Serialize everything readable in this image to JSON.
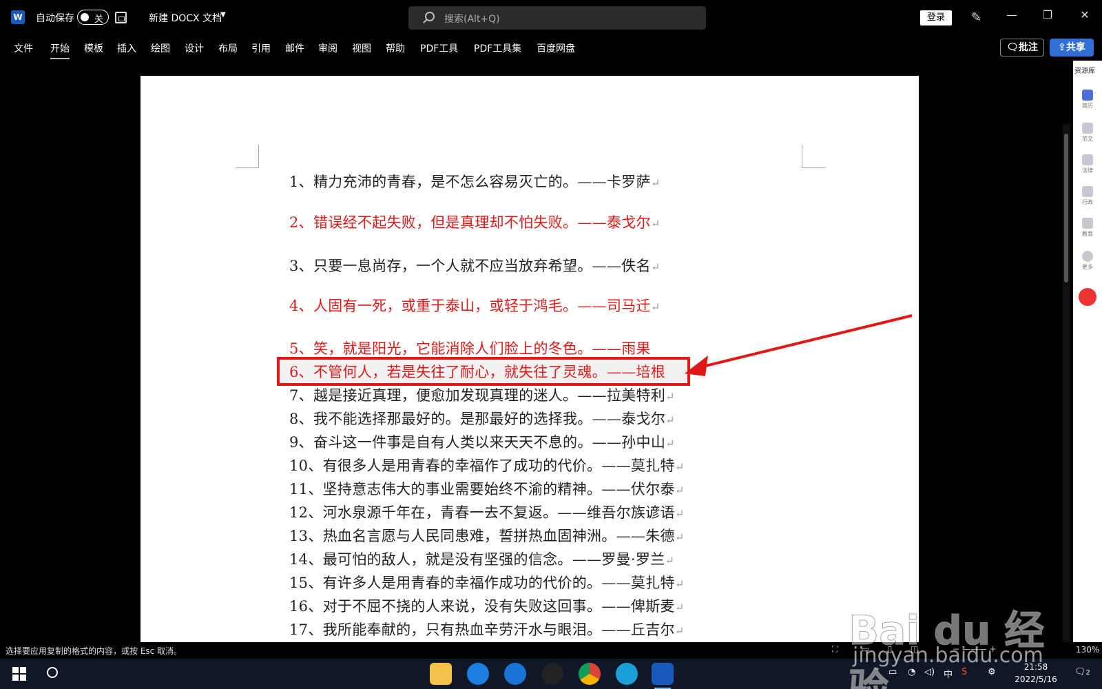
{
  "titlebar": {
    "app_icon": "word-icon",
    "autosave_label": "自动保存",
    "autosave_state": "关",
    "doc_title": "新建 DOCX 文档",
    "search_placeholder": "搜索(Alt+Q)",
    "login_label": "登录"
  },
  "ribbon": {
    "tabs": [
      "文件",
      "开始",
      "模板",
      "插入",
      "绘图",
      "设计",
      "布局",
      "引用",
      "邮件",
      "审阅",
      "视图",
      "帮助",
      "PDF工具",
      "PDF工具集",
      "百度网盘"
    ],
    "active_tab": "开始",
    "comment_label": "批注",
    "share_label": "共享"
  },
  "document": {
    "lines": [
      {
        "text": "1、精力充沛的青春，是不怎么容易灭亡的。——卡罗萨",
        "color": "black"
      },
      {
        "text": "2、错误经不起失败，但是真理却不怕失败。——泰戈尔",
        "color": "red"
      },
      {
        "text": "3、只要一息尚存，一个人就不应当放弃希望。——佚名",
        "color": "black"
      },
      {
        "text": "4、人固有一死，或重于泰山，或轻于鸿毛。——司马迁",
        "color": "red"
      },
      {
        "text": "5、笑，就是阳光，它能消除人们脸上的冬色。——雨果",
        "color": "red"
      },
      {
        "text": "6、不管何人，若是失往了耐心，就失往了灵魂。——培根",
        "color": "red"
      },
      {
        "text": "7、越是接近真理，便愈加发现真理的迷人。——拉美特利",
        "color": "black"
      },
      {
        "text": "8、我不能选择那最好的。是那最好的选择我。——泰戈尔",
        "color": "black"
      },
      {
        "text": "9、奋斗这一件事是自有人类以来天天不息的。——孙中山",
        "color": "black"
      },
      {
        "text": "10、有很多人是用青春的幸福作了成功的代价。——莫扎特",
        "color": "black"
      },
      {
        "text": "11、坚持意志伟大的事业需要始终不渝的精神。——伏尔泰",
        "color": "black"
      },
      {
        "text": "12、河水泉源千年在，青春一去不复返。——维吾尔族谚语",
        "color": "black"
      },
      {
        "text": "13、热血名言愿与人民同患难，誓拼热血固神洲。——朱德",
        "color": "black"
      },
      {
        "text": "14、最可怕的敌人，就是没有坚强的信念。——罗曼·罗兰",
        "color": "black"
      },
      {
        "text": "15、有许多人是用青春的幸福作成功的代价的。——莫扎特",
        "color": "black"
      },
      {
        "text": "16、对于不屈不挠的人来说，没有失败这回事。——俾斯麦",
        "color": "black"
      },
      {
        "text": "17、我所能奉献的，只有热血辛劳汗水与眼泪。——丘吉尔",
        "color": "black"
      }
    ]
  },
  "sidebar": {
    "title": "资源库",
    "items": [
      "简历",
      "范文",
      "法律",
      "行政",
      "教育",
      "更多"
    ]
  },
  "statusbar": {
    "message": "选择要应用复制的格式的内容，或按 Esc 取消。",
    "zoom": "130%"
  },
  "taskbar": {
    "ime": "中",
    "time": "21:58",
    "date": "2022/5/16",
    "notification_count": "2"
  },
  "watermark": {
    "brand": "Bai du 经验",
    "url": "jingyan.baidu.com"
  },
  "colors": {
    "red_text": "#e01818",
    "accent_blue": "#2f6fd6"
  }
}
